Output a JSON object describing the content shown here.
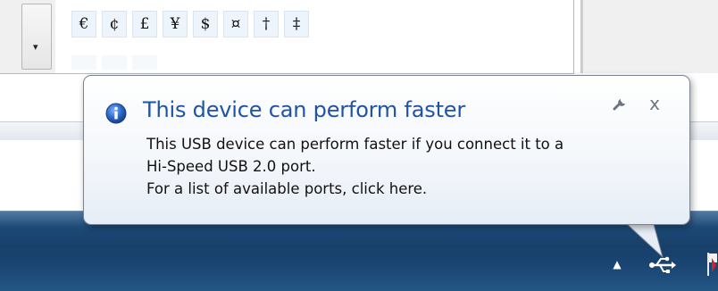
{
  "background_window": {
    "dropdown_arrow": "▾",
    "characters": [
      "€",
      "¢",
      "£",
      "¥",
      "$",
      "¤",
      "†",
      "‡"
    ]
  },
  "notification": {
    "title": "This device can perform faster",
    "body_lines": [
      "This USB device can perform faster if you connect it to a",
      "Hi-Speed USB 2.0 port.",
      "For a list of available ports, click here."
    ],
    "close_label": "x",
    "icons": [
      "info-icon",
      "wrench-icon",
      "close-icon"
    ]
  },
  "taskbar": {
    "tray_chevron": "▲",
    "icons": [
      "show-hidden-icons-chevron",
      "usb-icon",
      "action-center-flag-icon"
    ]
  },
  "colors": {
    "title_blue": "#1f53a7",
    "taskbar_blue": "#1d4a78",
    "info_icon_blue": "#2a66c9"
  }
}
